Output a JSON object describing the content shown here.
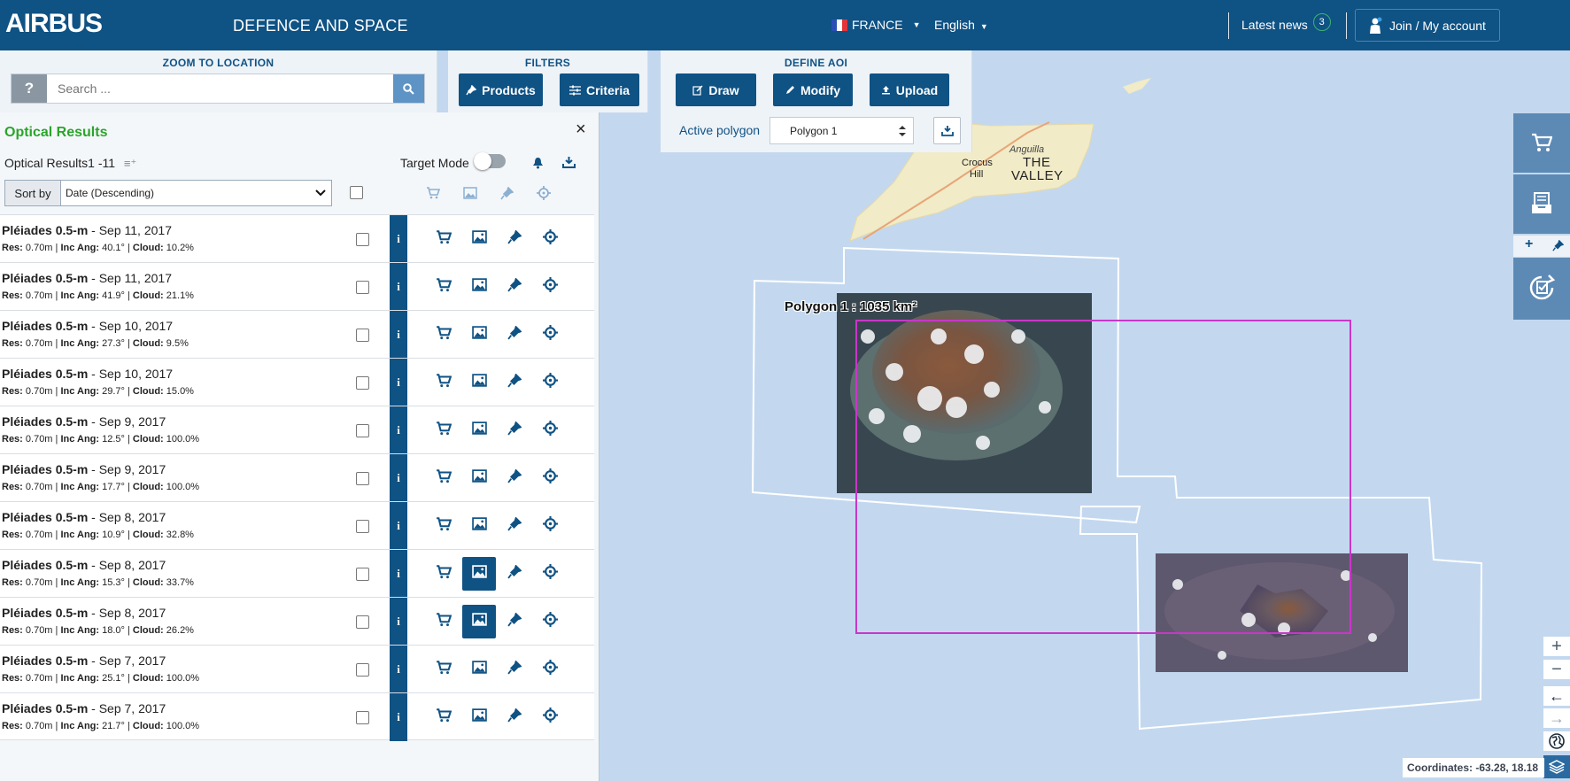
{
  "header": {
    "logo": "AIRBUS",
    "tagline": "DEFENCE AND SPACE",
    "country": "FRANCE",
    "language": "English",
    "latest_news": "Latest news",
    "news_count": "3",
    "account": "Join / My account"
  },
  "zoom": {
    "title": "ZOOM TO LOCATION",
    "help": "?",
    "placeholder": "Search ..."
  },
  "filters": {
    "title": "FILTERS",
    "products": "Products",
    "criteria": "Criteria"
  },
  "aoi": {
    "title": "DEFINE AOI",
    "draw": "Draw",
    "modify": "Modify",
    "upload": "Upload",
    "active_label": "Active polygon",
    "active_value": "Polygon 1"
  },
  "results": {
    "title": "Optical Results",
    "close": "×",
    "subtitle": "Optical Results1 -11",
    "target_mode": "Target Mode",
    "sort_label": "Sort by",
    "sort_value": "Date (Descending)",
    "items": [
      {
        "product": "Pléiades 0.5-m",
        "date": " - Sep 11, 2017",
        "res": " 0.70m | ",
        "inc": "  40.1° | ",
        "cloud": " 10.2%",
        "preview_active": false
      },
      {
        "product": "Pléiades 0.5-m",
        "date": " - Sep 11, 2017",
        "res": " 0.70m | ",
        "inc": "  41.9° | ",
        "cloud": " 21.1%",
        "preview_active": false
      },
      {
        "product": "Pléiades 0.5-m",
        "date": " - Sep 10, 2017",
        "res": " 0.70m | ",
        "inc": "  27.3° | ",
        "cloud": " 9.5%",
        "preview_active": false
      },
      {
        "product": "Pléiades 0.5-m",
        "date": " - Sep 10, 2017",
        "res": " 0.70m | ",
        "inc": "  29.7° | ",
        "cloud": " 15.0%",
        "preview_active": false
      },
      {
        "product": "Pléiades 0.5-m",
        "date": " - Sep 9, 2017",
        "res": " 0.70m | ",
        "inc": "  12.5° | ",
        "cloud": " 100.0%",
        "preview_active": false
      },
      {
        "product": "Pléiades 0.5-m",
        "date": " - Sep 9, 2017",
        "res": " 0.70m | ",
        "inc": "  17.7° | ",
        "cloud": " 100.0%",
        "preview_active": false
      },
      {
        "product": "Pléiades 0.5-m",
        "date": " - Sep 8, 2017",
        "res": " 0.70m | ",
        "inc": "  10.9° | ",
        "cloud": " 32.8%",
        "preview_active": false
      },
      {
        "product": "Pléiades 0.5-m",
        "date": " - Sep 8, 2017",
        "res": " 0.70m | ",
        "inc": "  15.3° | ",
        "cloud": " 33.7%",
        "preview_active": true
      },
      {
        "product": "Pléiades 0.5-m",
        "date": " - Sep 8, 2017",
        "res": " 0.70m | ",
        "inc": "  18.0° | ",
        "cloud": " 26.2%",
        "preview_active": true
      },
      {
        "product": "Pléiades 0.5-m",
        "date": " - Sep 7, 2017",
        "res": " 0.70m | ",
        "inc": "  25.1° | ",
        "cloud": " 100.0%",
        "preview_active": false
      },
      {
        "product": "Pléiades 0.5-m",
        "date": " - Sep 7, 2017",
        "res": " 0.70m | ",
        "inc": "  21.7° | ",
        "cloud": " 100.0%",
        "preview_active": false
      }
    ],
    "labels": {
      "res": "Res:",
      "inc": "Inc Ang:",
      "cloud": "Cloud:",
      "info": "i"
    }
  },
  "map": {
    "polygon_label": "Polygon 1 : 1035 km²",
    "place_anguilla": "Anguilla",
    "place_valley1": "THE",
    "place_valley2": "VALLEY",
    "place_crocus1": "Crocus",
    "place_crocus2": "Hill",
    "coordinates": "Coordinates: -63.28, 18.18"
  },
  "colors": {
    "brand": "#0f5284",
    "results_title": "#2aa52a",
    "aoi_outline": "#c837c8"
  }
}
